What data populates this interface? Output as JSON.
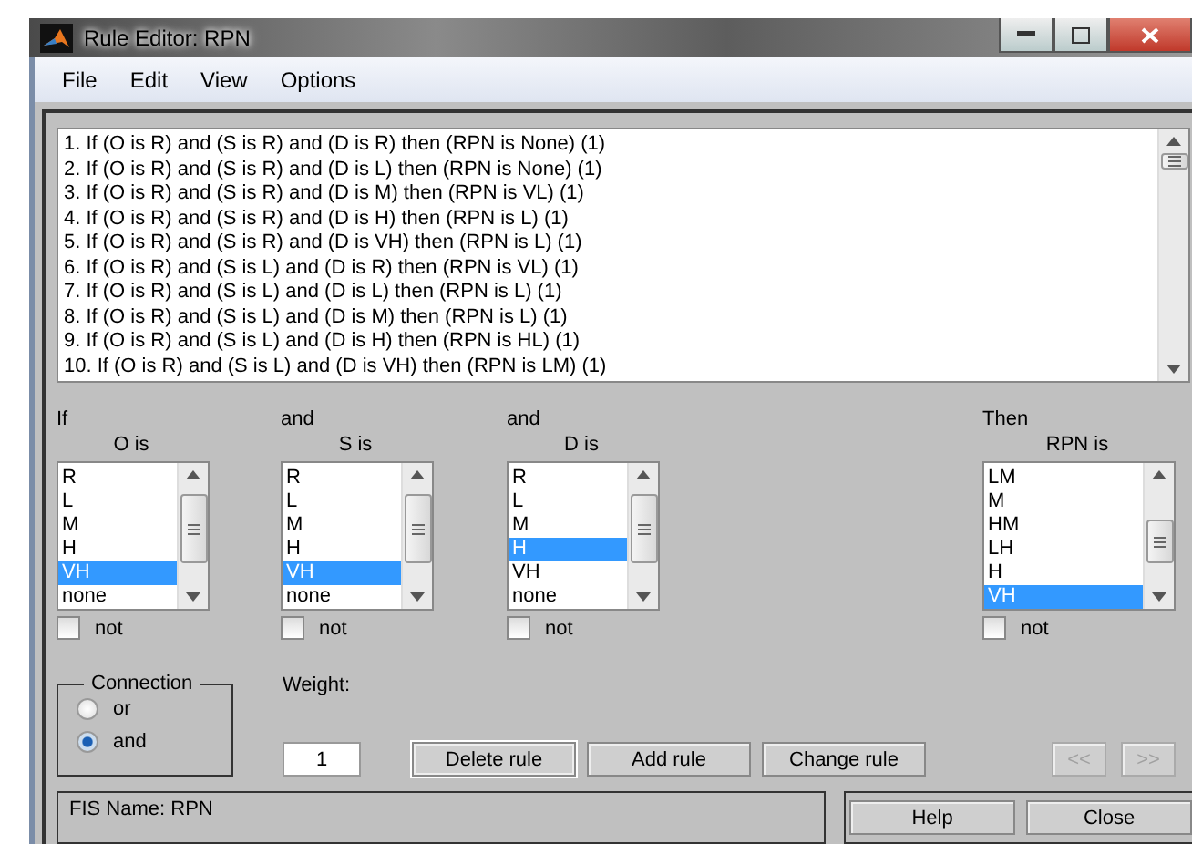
{
  "window": {
    "title": "Rule Editor: RPN"
  },
  "menu": [
    "File",
    "Edit",
    "View",
    "Options"
  ],
  "rules": [
    "1. If (O is R) and (S is R) and (D is R) then (RPN is None) (1)",
    "2. If (O is R) and (S is R) and (D is L) then (RPN is None) (1)",
    "3. If (O is R) and (S is R) and (D is M) then (RPN is VL) (1)",
    "4. If (O is R) and (S is R) and (D is H) then (RPN is L) (1)",
    "5. If (O is R) and (S is R) and (D is VH) then (RPN is L) (1)",
    "6. If (O is R) and (S is L) and (D is R) then (RPN is VL) (1)",
    "7. If (O is R) and (S is L) and (D is L) then (RPN is L) (1)",
    "8. If (O is R) and (S is L) and (D is M) then (RPN is L) (1)",
    "9. If (O is R) and (S is L) and (D is H) then (RPN is HL) (1)",
    "10. If (O is R) and (S is L) and (D is VH) then (RPN is LM) (1)"
  ],
  "variables": [
    {
      "connector": "If",
      "label": "O is",
      "not_label": "not",
      "not": false,
      "options": [
        {
          "text": "R",
          "selected": false
        },
        {
          "text": "L",
          "selected": false
        },
        {
          "text": "M",
          "selected": false
        },
        {
          "text": "H",
          "selected": false
        },
        {
          "text": "VH",
          "selected": true
        },
        {
          "text": "none",
          "selected": false
        }
      ]
    },
    {
      "connector": "and",
      "label": "S is",
      "not_label": "not",
      "not": false,
      "options": [
        {
          "text": "R",
          "selected": false
        },
        {
          "text": "L",
          "selected": false
        },
        {
          "text": "M",
          "selected": false
        },
        {
          "text": "H",
          "selected": false
        },
        {
          "text": "VH",
          "selected": true
        },
        {
          "text": "none",
          "selected": false
        }
      ]
    },
    {
      "connector": "and",
      "label": "D is",
      "not_label": "not",
      "not": false,
      "options": [
        {
          "text": "R",
          "selected": false
        },
        {
          "text": "L",
          "selected": false
        },
        {
          "text": "M",
          "selected": false
        },
        {
          "text": "H",
          "selected": true
        },
        {
          "text": "VH",
          "selected": false
        },
        {
          "text": "none",
          "selected": false
        }
      ]
    },
    {
      "connector": "Then",
      "label": "RPN is",
      "not_label": "not",
      "not": false,
      "options": [
        {
          "text": "LM",
          "selected": false
        },
        {
          "text": "M",
          "selected": false
        },
        {
          "text": "HM",
          "selected": false
        },
        {
          "text": "LH",
          "selected": false
        },
        {
          "text": "H",
          "selected": false
        },
        {
          "text": "VH",
          "selected": true
        }
      ]
    }
  ],
  "connection": {
    "title": "Connection",
    "options": [
      {
        "label": "or",
        "selected": false
      },
      {
        "label": "and",
        "selected": true
      }
    ]
  },
  "weight": {
    "label": "Weight:",
    "value": "1"
  },
  "actions": [
    {
      "label": "Delete rule",
      "focused": true
    },
    {
      "label": "Add rule",
      "focused": false
    },
    {
      "label": "Change rule",
      "focused": false
    }
  ],
  "nav": [
    {
      "label": "<<",
      "disabled": true
    },
    {
      "label": ">>",
      "disabled": true
    }
  ],
  "status": "FIS Name: RPN",
  "footer_buttons": [
    "Help",
    "Close"
  ]
}
